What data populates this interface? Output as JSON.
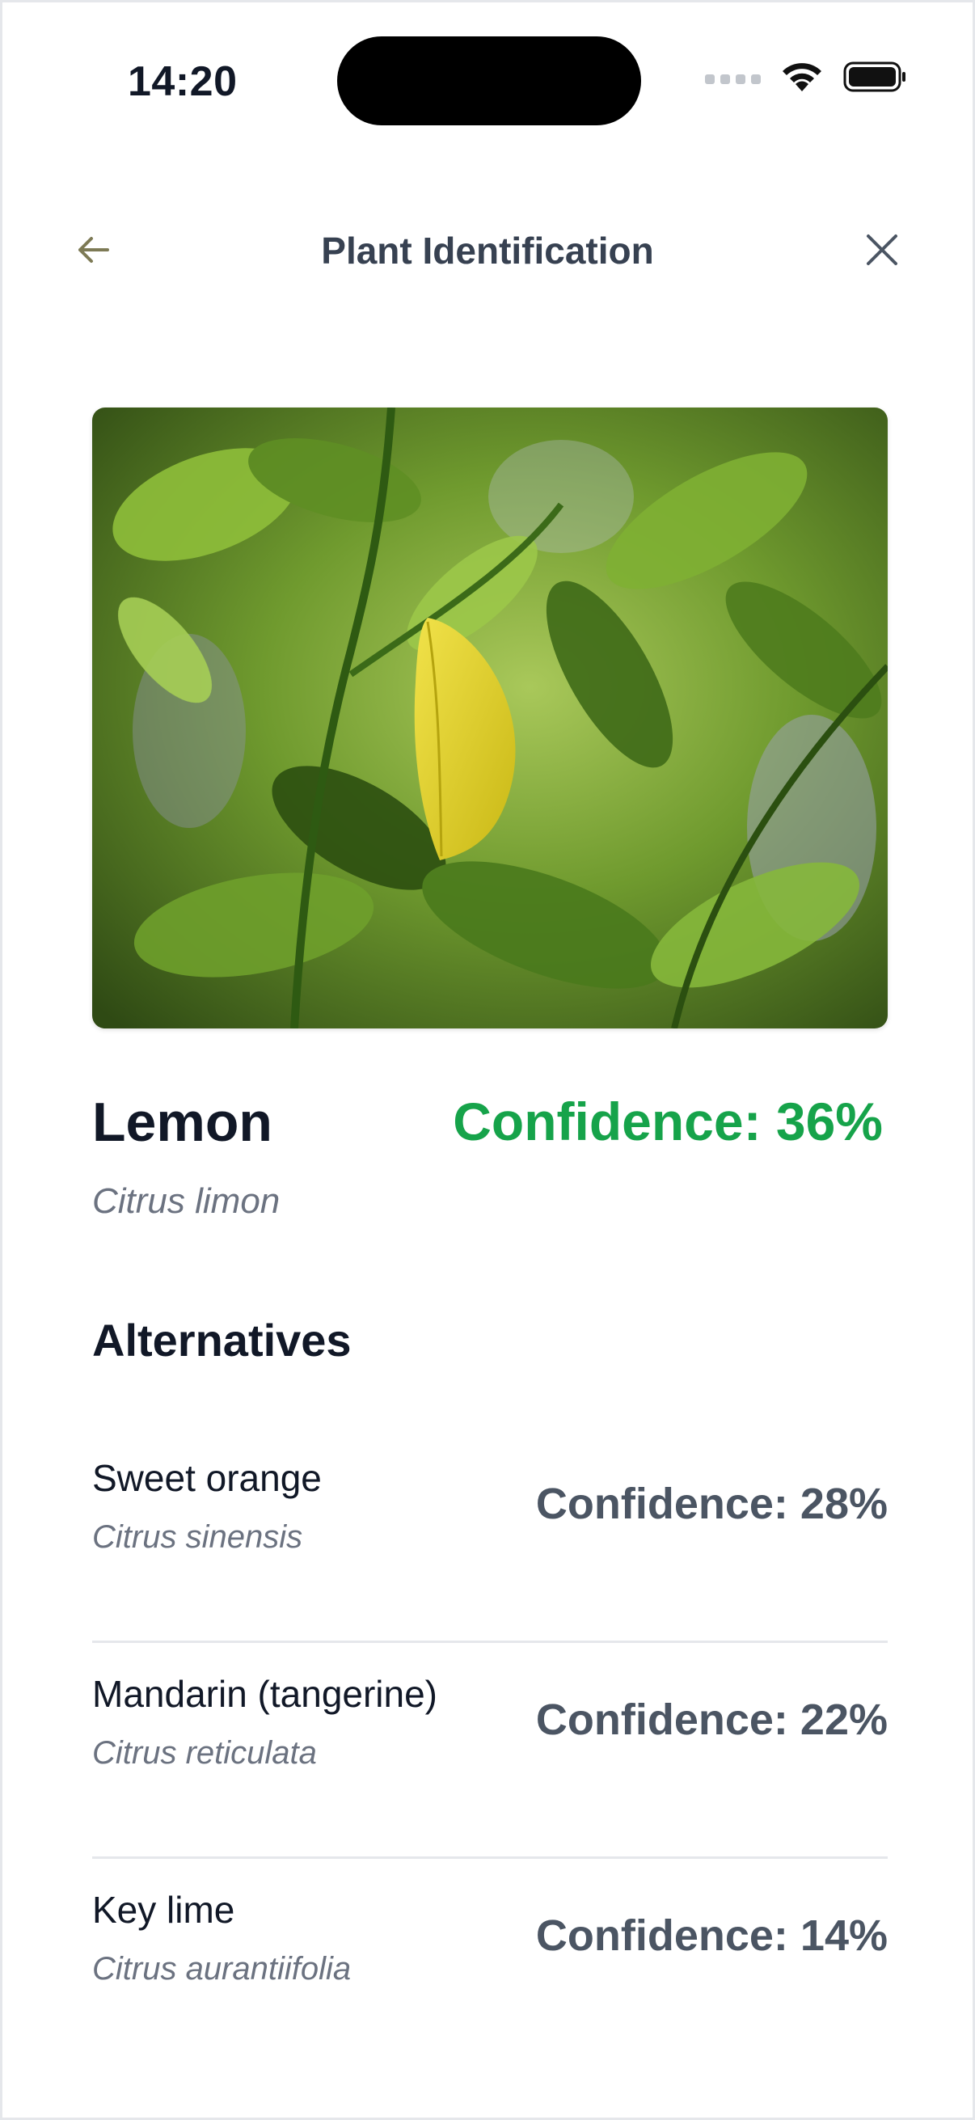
{
  "status_bar": {
    "time": "14:20"
  },
  "header": {
    "title": "Plant Identification",
    "back_icon": "arrow-left-icon",
    "close_icon": "close-icon"
  },
  "photo": {
    "subject": "leafy-plant-photo"
  },
  "result": {
    "name": "Lemon",
    "scientific_name": "Citrus limon",
    "confidence_text": "Confidence: 36%",
    "confidence_value": 36,
    "confidence_color": "#16a34a"
  },
  "alternatives": {
    "title": "Alternatives",
    "items": [
      {
        "name": "Sweet orange",
        "scientific_name": "Citrus sinensis",
        "confidence_text": "Confidence: 28%",
        "confidence_value": 28
      },
      {
        "name": "Mandarin (tangerine)",
        "scientific_name": "Citrus reticulata",
        "confidence_text": "Confidence: 22%",
        "confidence_value": 22
      },
      {
        "name": "Key lime",
        "scientific_name": "Citrus aurantiifolia",
        "confidence_text": "Confidence: 14%",
        "confidence_value": 14
      }
    ]
  }
}
